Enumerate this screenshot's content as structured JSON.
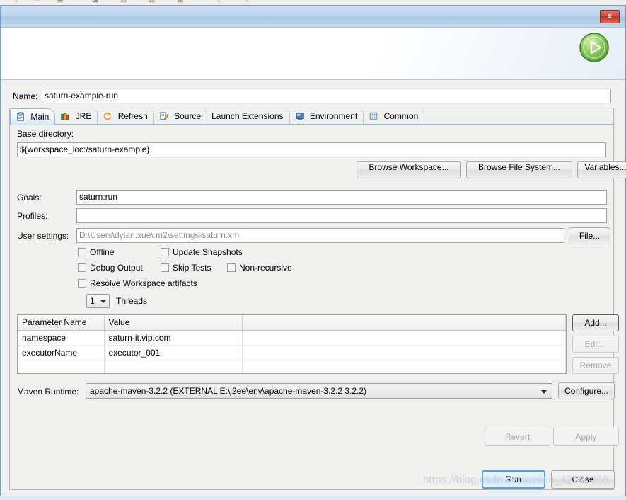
{
  "window": {
    "close_button": "x",
    "run_icon": "run-play-icon"
  },
  "name_field": {
    "label": "Name:",
    "value": "saturn-example-run"
  },
  "tabs": [
    {
      "label": "Main",
      "icon": "main-document-icon",
      "selected": true
    },
    {
      "label": "JRE",
      "icon": "jre-books-icon",
      "selected": false
    },
    {
      "label": "Refresh",
      "icon": "refresh-arrows-icon",
      "selected": false
    },
    {
      "label": "Source",
      "icon": "source-edit-icon",
      "selected": false
    },
    {
      "label": "Launch Extensions",
      "icon": "",
      "selected": false
    },
    {
      "label": "Environment",
      "icon": "environment-monitor-icon",
      "selected": false
    },
    {
      "label": "Common",
      "icon": "common-table-icon",
      "selected": false
    }
  ],
  "main": {
    "base_directory": {
      "label": "Base directory:",
      "value": "${workspace_loc:/saturn-example}"
    },
    "browse_buttons": [
      {
        "label": "Browse Workspace...",
        "name": "browse-workspace-button"
      },
      {
        "label": "Browse File System...",
        "name": "browse-file-system-button"
      },
      {
        "label": "Variables...",
        "name": "variables-button"
      }
    ],
    "goals": {
      "label": "Goals:",
      "value": "saturn:run"
    },
    "profiles": {
      "label": "Profiles:",
      "value": ""
    },
    "user_settings": {
      "label": "User settings:",
      "value": "",
      "placeholder": "D:\\Users\\dylan.xue\\.m2\\settings-saturn.xml",
      "file_button": "File..."
    },
    "checkboxes": [
      {
        "label": "Offline",
        "checked": false,
        "name": "checkbox-offline"
      },
      {
        "label": "Update Snapshots",
        "checked": false,
        "name": "checkbox-update-snapshots"
      },
      {
        "label": "Debug Output",
        "checked": false,
        "name": "checkbox-debug-output"
      },
      {
        "label": "Skip Tests",
        "checked": false,
        "name": "checkbox-skip-tests"
      },
      {
        "label": "Non-recursive",
        "checked": false,
        "name": "checkbox-non-recursive"
      },
      {
        "label": "Resolve Workspace artifacts",
        "checked": false,
        "name": "checkbox-resolve-workspace-artifacts"
      }
    ],
    "threads": {
      "value": "1",
      "label": "Threads"
    },
    "parameters_table": {
      "columns": [
        "Parameter Name",
        "Value",
        ""
      ],
      "rows": [
        {
          "name": "namespace",
          "value": "saturn-it.vip.com"
        },
        {
          "name": "executorName",
          "value": "executor_001"
        }
      ],
      "buttons": [
        {
          "label": "Add...",
          "enabled": true
        },
        {
          "label": "Edit...",
          "enabled": false
        },
        {
          "label": "Remove",
          "enabled": false
        }
      ]
    },
    "maven_runtime": {
      "label": "Maven Runtime:",
      "value": "apache-maven-3.2.2 (EXTERNAL E:\\j2ee\\env\\apache-maven-3.2.2 3.2.2)",
      "configure_button": "Configure..."
    }
  },
  "footer": {
    "revert": "Revert",
    "apply": "Apply",
    "run": "Run",
    "close": "Close"
  },
  "watermark": "https://blog.csdn.net/weixin_42528268",
  "colors": {
    "accent_blue": "#5aa0d8",
    "dialog_bg": "#f0f0ef",
    "close_red": "#cf4a3a",
    "run_green": "#6cbf3f"
  }
}
